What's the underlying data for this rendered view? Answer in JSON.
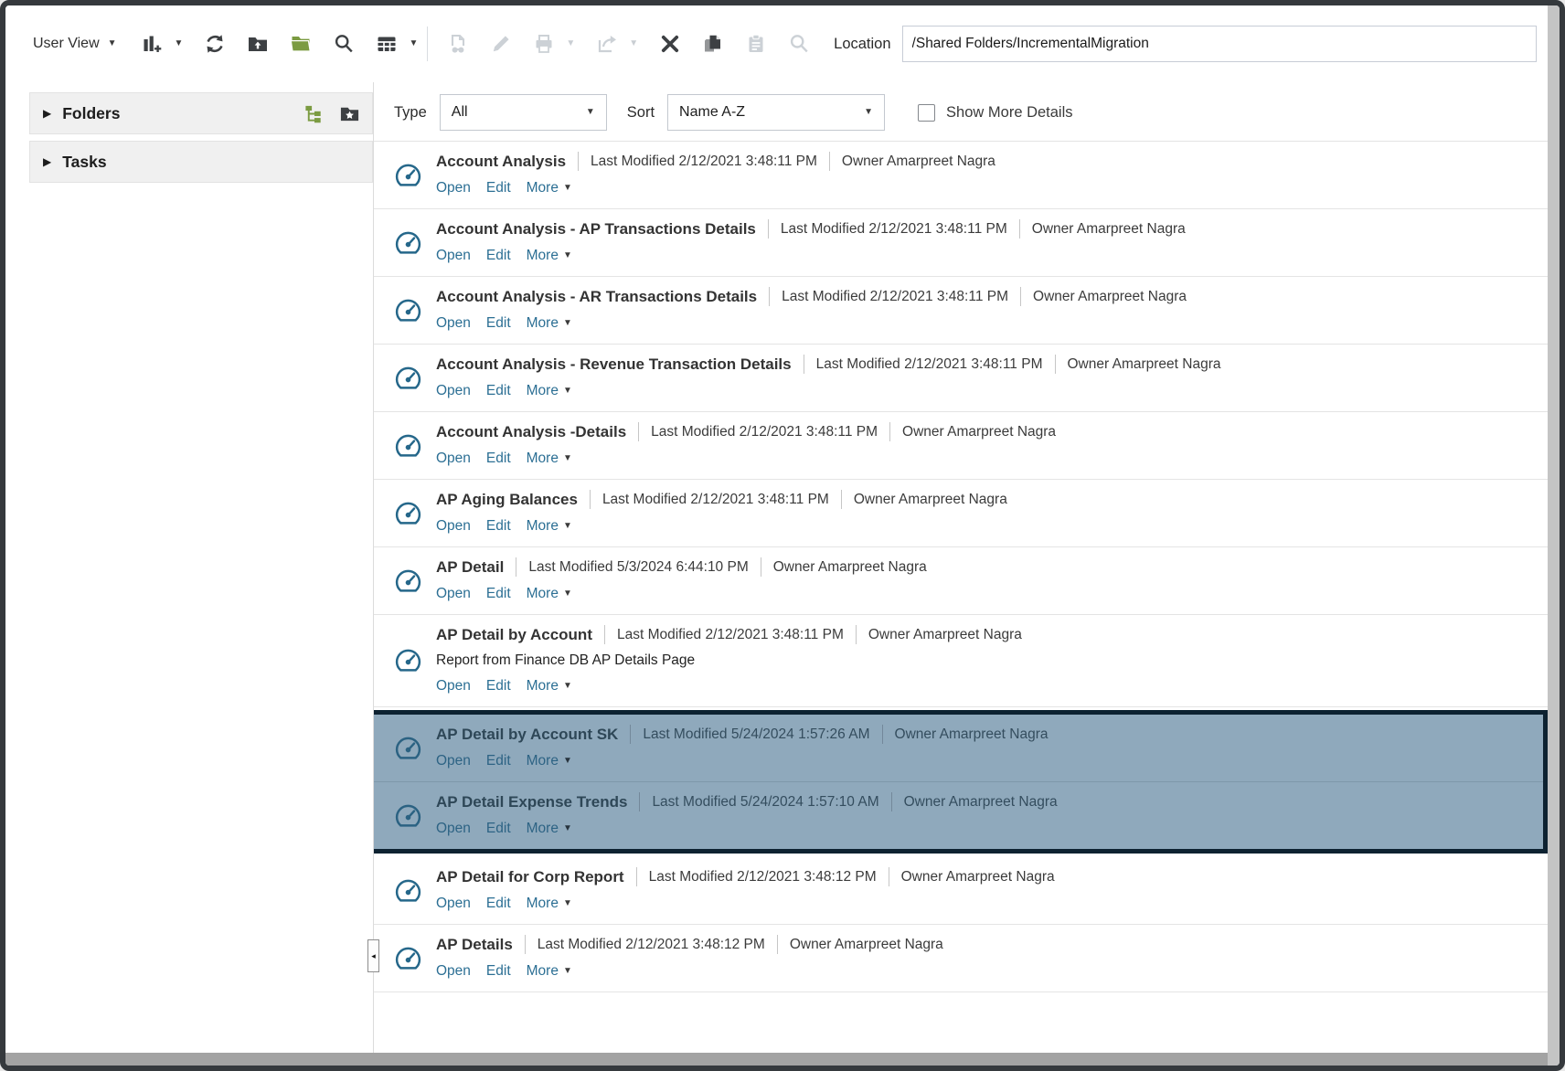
{
  "toolbar": {
    "user_view_label": "User View",
    "location_label": "Location",
    "location_value": "/Shared Folders/IncrementalMigration",
    "left_icons": [
      "new-object",
      "refresh",
      "upload-folder",
      "copy-folder",
      "search",
      "list-view"
    ],
    "action_icons": [
      "open",
      "edit",
      "print",
      "export",
      "delete",
      "copy",
      "paste",
      "preview"
    ]
  },
  "sidebar": {
    "panels": [
      {
        "label": "Folders",
        "icons": [
          "tree-view",
          "favorites-folder"
        ]
      },
      {
        "label": "Tasks",
        "icons": []
      }
    ]
  },
  "filters": {
    "type_label": "Type",
    "type_value": "All",
    "sort_label": "Sort",
    "sort_value": "Name A-Z",
    "show_more_details_label": "Show More Details",
    "show_more_details_checked": false
  },
  "actions": {
    "open": "Open",
    "edit": "Edit",
    "more": "More"
  },
  "glyphs": {
    "caret_down": "▼",
    "caret_right": "▶",
    "splitter_left": "◂"
  },
  "list": {
    "items": [
      {
        "title": "Account Analysis",
        "modified": "Last Modified 2/12/2021 3:48:11 PM",
        "owner": "Owner Amarpreet Nagra"
      },
      {
        "title": "Account Analysis - AP Transactions Details",
        "modified": "Last Modified 2/12/2021 3:48:11 PM",
        "owner": "Owner Amarpreet Nagra"
      },
      {
        "title": "Account Analysis - AR Transactions Details",
        "modified": "Last Modified 2/12/2021 3:48:11 PM",
        "owner": "Owner Amarpreet Nagra"
      },
      {
        "title": "Account Analysis - Revenue Transaction Details",
        "modified": "Last Modified 2/12/2021 3:48:11 PM",
        "owner": "Owner Amarpreet Nagra"
      },
      {
        "title": "Account Analysis -Details",
        "modified": "Last Modified 2/12/2021 3:48:11 PM",
        "owner": "Owner Amarpreet Nagra"
      },
      {
        "title": "AP Aging Balances",
        "modified": "Last Modified 2/12/2021 3:48:11 PM",
        "owner": "Owner Amarpreet Nagra"
      },
      {
        "title": "AP Detail",
        "modified": "Last Modified 5/3/2024 6:44:10 PM",
        "owner": "Owner Amarpreet Nagra"
      },
      {
        "title": "AP Detail by Account",
        "modified": "Last Modified 2/12/2021 3:48:11 PM",
        "owner": "Owner Amarpreet Nagra",
        "description": "Report from Finance DB AP Details Page"
      },
      {
        "title": "AP Detail by Account SK",
        "modified": "Last Modified 5/24/2024 1:57:26 AM",
        "owner": "Owner Amarpreet Nagra",
        "selected": true
      },
      {
        "title": "AP Detail Expense Trends",
        "modified": "Last Modified 5/24/2024 1:57:10 AM",
        "owner": "Owner Amarpreet Nagra",
        "selected": true
      },
      {
        "title": "AP Detail for Corp Report",
        "modified": "Last Modified 2/12/2021 3:48:12 PM",
        "owner": "Owner Amarpreet Nagra"
      },
      {
        "title": "AP Details",
        "modified": "Last Modified 2/12/2021 3:48:12 PM",
        "owner": "Owner Amarpreet Nagra"
      }
    ]
  },
  "colors": {
    "link": "#2c6f94",
    "item_icon": "#25678a",
    "selection_fill": "#8fa9bc",
    "selection_border": "#0d2231",
    "toolbar_icon": "#3d4043",
    "toolbar_icon_disabled": "#ccd1d6",
    "green_icon": "#7b9b41"
  }
}
